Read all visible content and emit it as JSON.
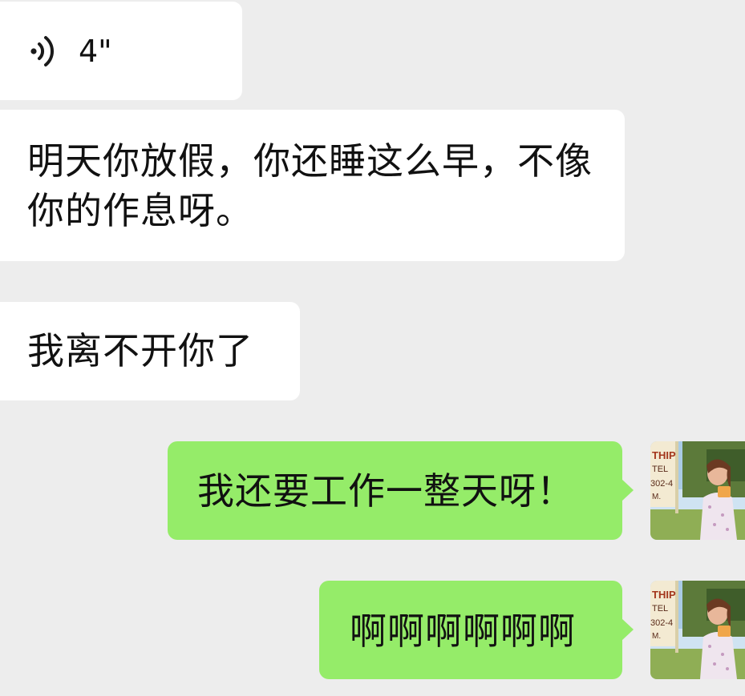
{
  "messages": [
    {
      "id": "voice",
      "direction": "incoming",
      "type": "voice",
      "duration": "4\""
    },
    {
      "id": "msg1",
      "direction": "incoming",
      "type": "text",
      "text": "明天你放假，你还睡这么早，不像你的作息呀。"
    },
    {
      "id": "msg2",
      "direction": "incoming",
      "type": "text",
      "text": "我离不开你了"
    },
    {
      "id": "msg3",
      "direction": "outgoing",
      "type": "text",
      "text": "我还要工作一整天呀！"
    },
    {
      "id": "msg4",
      "direction": "outgoing",
      "type": "text",
      "text": "啊啊啊啊啊啊"
    }
  ],
  "avatar": {
    "sign_text": [
      "THIP",
      "TEL",
      "302-4",
      "M."
    ]
  },
  "icons": {
    "voice": "voice-wave-icon"
  },
  "colors": {
    "background": "#ededed",
    "incoming_bubble": "#ffffff",
    "outgoing_bubble": "#95ec69",
    "text": "#111111"
  }
}
